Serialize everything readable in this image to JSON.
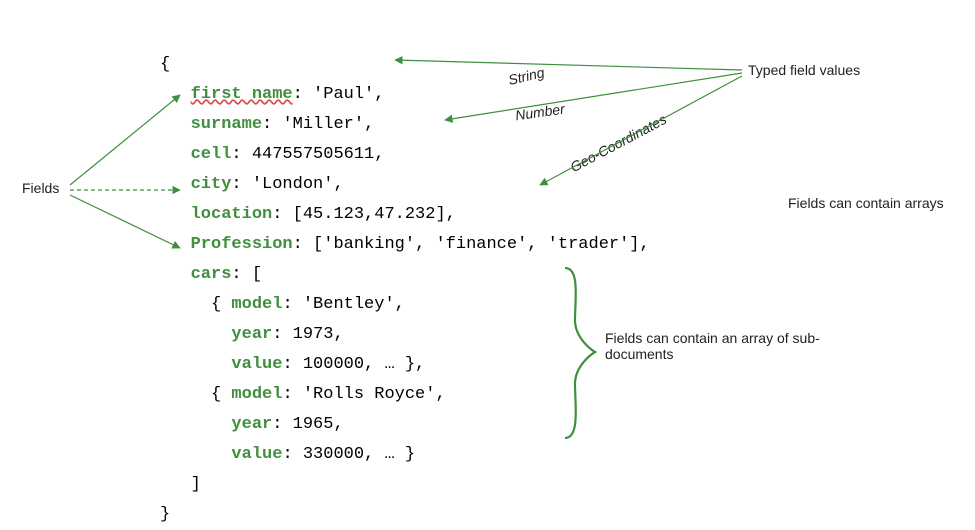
{
  "doc": {
    "open": "{",
    "close": "}",
    "array_close": "]",
    "fields": {
      "first_name": {
        "key": "first name",
        "value": "'Paul'"
      },
      "surname": {
        "key": "surname",
        "value": "'Miller'"
      },
      "cell": {
        "key": "cell",
        "value": "447557505611"
      },
      "city": {
        "key": "city",
        "value": "'London'"
      },
      "location": {
        "key": "location",
        "value": "[45.123,47.232]"
      },
      "profession": {
        "key": "Profession",
        "value": "['banking', 'finance', 'trader']"
      },
      "cars": {
        "key": "cars",
        "open": "["
      }
    },
    "cars": [
      {
        "model_key": "model",
        "model": "'Bentley'",
        "year_key": "year",
        "year": "1973",
        "value_key": "value",
        "value": "100000, … },"
      },
      {
        "model_key": "model",
        "model": "'Rolls Royce'",
        "year_key": "year",
        "year": "1965",
        "value_key": "value",
        "value": "330000, … }"
      }
    ]
  },
  "labels": {
    "fields": "Fields",
    "typed": "Typed field values",
    "string": "String",
    "number": "Number",
    "geo": "Geo-Coordinates",
    "arrays": "Fields can contain arrays",
    "subdocs": "Fields can contain an array of sub-documents"
  }
}
